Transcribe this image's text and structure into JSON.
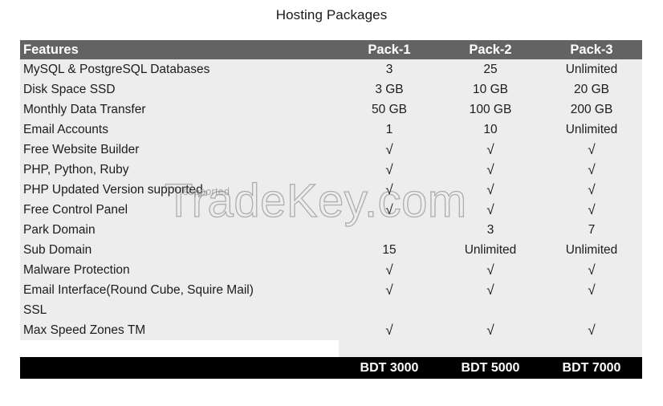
{
  "page": {
    "title": "Hosting Packages",
    "background_color": "#ffffff"
  },
  "watermark": {
    "main_text": "TradeKey.com",
    "sub_text": "supported",
    "stroke_color": "#787878"
  },
  "theme": {
    "header_bg": "#636363",
    "header_text": "#ffffff",
    "body_bg": "#ededed",
    "body_text": "#1c1c1c",
    "footer_bg": "#000000",
    "footer_text": "#ffffff"
  },
  "table": {
    "columns": [
      {
        "key": "feature",
        "label": "Features",
        "align": "left"
      },
      {
        "key": "pack1",
        "label": "Pack-1",
        "align": "center"
      },
      {
        "key": "pack2",
        "label": "Pack-2",
        "align": "center"
      },
      {
        "key": "pack3",
        "label": "Pack-3",
        "align": "center"
      }
    ],
    "rows": [
      {
        "feature": "MySQL & PostgreSQL Databases",
        "pack1": "3",
        "pack2": "25",
        "pack3": "Unlimited"
      },
      {
        "feature": "Disk Space SSD",
        "pack1": "3 GB",
        "pack2": "10 GB",
        "pack3": "20 GB"
      },
      {
        "feature": "Monthly Data Transfer",
        "pack1": "50 GB",
        "pack2": "100 GB",
        "pack3": "200 GB"
      },
      {
        "feature": "Email Accounts",
        "pack1": "1",
        "pack2": "10",
        "pack3": "Unlimited"
      },
      {
        "feature": "Free Website Builder",
        "pack1": "√",
        "pack2": "√",
        "pack3": "√"
      },
      {
        "feature": "PHP, Python, Ruby",
        "pack1": "√",
        "pack2": "√",
        "pack3": "√"
      },
      {
        "feature": "PHP Updated Version supported",
        "pack1": "√",
        "pack2": "√",
        "pack3": "√"
      },
      {
        "feature": "Free Control Panel",
        "pack1": "√",
        "pack2": "√",
        "pack3": "√"
      },
      {
        "feature": "Park Domain",
        "pack1": "",
        "pack2": "3",
        "pack3": "7"
      },
      {
        "feature": "Sub Domain",
        "pack1": "15",
        "pack2": "Unlimited",
        "pack3": "Unlimited"
      },
      {
        "feature": "Malware Protection",
        "pack1": "√",
        "pack2": "√",
        "pack3": "√"
      },
      {
        "feature": "Email Interface(Round Cube, Squire Mail)",
        "pack1": "√",
        "pack2": "√",
        "pack3": "√"
      },
      {
        "feature": "SSL",
        "pack1": "",
        "pack2": "",
        "pack3": ""
      },
      {
        "feature": "Max Speed Zones TM",
        "pack1": "√",
        "pack2": "√",
        "pack3": "√"
      }
    ],
    "footer": {
      "feature": "",
      "pack1": "BDT 3000",
      "pack2": "BDT 5000",
      "pack3": "BDT 7000"
    }
  }
}
